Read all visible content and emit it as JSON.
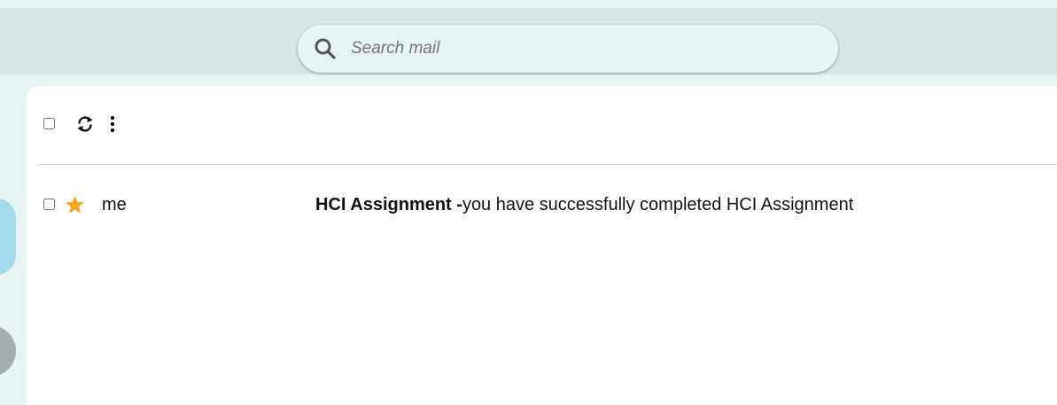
{
  "search": {
    "placeholder": "Search mail",
    "icon": "search-icon"
  },
  "toolbar": {
    "icons": [
      "checkbox",
      "refresh-icon",
      "more-vert-icon"
    ]
  },
  "emails": [
    {
      "sender": "me",
      "subject": "HCI Assignment -",
      "snippet": "you have successfully completed HCI Assignment",
      "starred": true
    }
  ],
  "colors": {
    "header_bg": "#d8e6e6",
    "page_bg": "#e8f4f4",
    "star": "#f5a623",
    "rail_active": "#a2dcec",
    "rail_avatar": "#a6adad"
  }
}
